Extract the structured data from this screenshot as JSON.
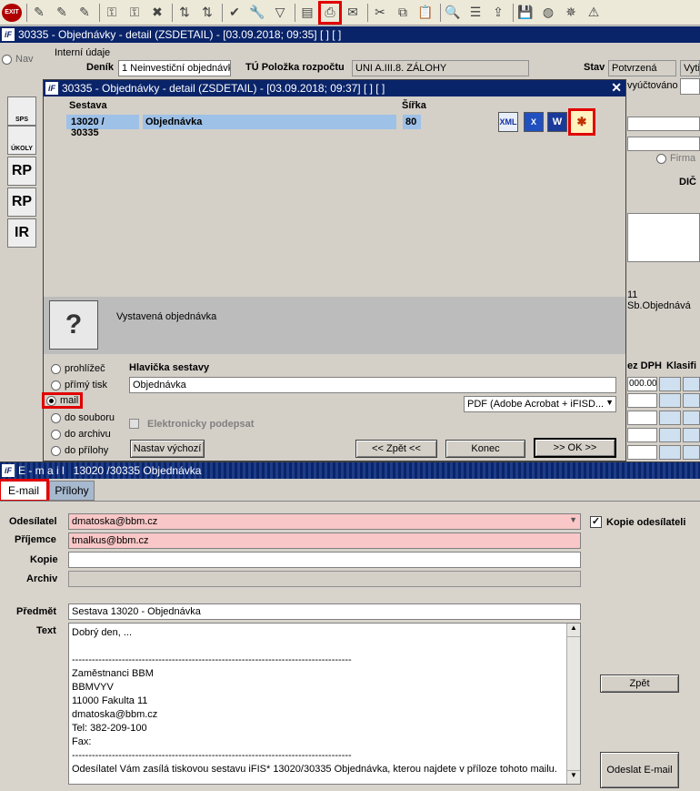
{
  "toolbar": {
    "icons": [
      "exit-icon",
      "edit-icon",
      "edit-icon",
      "edit-icon",
      "lock-icon",
      "lock-icon",
      "delete-icon",
      "sort-icon",
      "sort-icon",
      "check-icon",
      "wrench-icon",
      "filter-icon",
      "print-preview-icon",
      "print-icon",
      "email-icon",
      "cut-icon",
      "copy-icon",
      "paste-icon",
      "find-icon",
      "list-icon",
      "export-icon",
      "save-icon",
      "globe-icon",
      "wheel-icon",
      "sign-icon"
    ],
    "exit_label": "EXIT"
  },
  "main_window": {
    "title": "30335 - Objednávky - detail (ZSDETAIL) - [03.09.2018; 09:35]  [ ]  [ ]",
    "nav_label": "Nav",
    "group_label": "Interní údaje",
    "denik_label": "Deník",
    "denik_value": "1 Neinvestiční objednávk",
    "tu_label": "TÚ Položka rozpočtu",
    "tu_value": "UNI A.III.8. ZÁLOHY",
    "stav_label": "Stav",
    "stav_value": "Potvrzená",
    "stav_extra": "Vyti",
    "vyuctovano": "vyúčtováno",
    "firma_label": "Firma",
    "dic_label": "DIČ",
    "sb_obj": "11 Sb.Objednává",
    "col_dph": "ez DPH",
    "col_klasif": "Klasifi",
    "amount": "000.00"
  },
  "sidebar": [
    "SPS",
    "ÚKOLY",
    "RP",
    "RP",
    "IR"
  ],
  "report_dialog": {
    "title": "30335 - Objednávky - detail (ZSDETAIL) - [03.09.2018; 09:37]  [ ]  [ ]",
    "col_sestava": "Sestava",
    "col_sirka": "Šířka",
    "row_code": "13020 / 30335",
    "row_name": "Objednávka",
    "row_width": "80",
    "format_icons": [
      "XML",
      "X",
      "W",
      "✱"
    ],
    "description": "Vystavená objednávka",
    "output_options": [
      "prohlížeč",
      "přímý tisk",
      "mail",
      "do souboru",
      "do archivu",
      "do přílohy"
    ],
    "selected_option": "mail",
    "header_label": "Hlavička sestavy",
    "header_value": "Objednávka",
    "format_select": "PDF (Adobe Acrobat + iFISD...",
    "e_sign_label": "Elektronicky podepsat",
    "btn_default": "Nastav výchozí",
    "btn_back": "<< Zpět <<",
    "btn_end": "Konec",
    "btn_ok": ">> OK >>"
  },
  "email_window": {
    "title": "E - m a i l   13020 /30335 Objednávka",
    "tabs": [
      "E-mail",
      "Přílohy"
    ],
    "active_tab": "E-mail",
    "from_label": "Odesílatel",
    "from_value": "dmatoska@bbm.cz",
    "copy_sender_label": "Kopie odesílateli",
    "copy_sender_checked": true,
    "to_label": "Příjemce",
    "to_value": "tmalkus@bbm.cz",
    "cc_label": "Kopie",
    "cc_value": "",
    "archive_label": "Archiv",
    "archive_value": "",
    "subject_label": "Předmět",
    "subject_value": "Sestava 13020 - Objednávka",
    "text_label": "Text",
    "body_text": "Dobrý den, ...\n\n------------------------------------------------------------------------------------\nZaměstnanci BBM\nBBMVYV\n11000 Fakulta 11\ndmatoska@bbm.cz\nTel: 382-209-100\nFax:\n------------------------------------------------------------------------------------\nOdesílatel Vám zasílá tiskovou sestavu iFIS* 13020/30335 Objednávka, kterou najdete v příloze tohoto mailu.",
    "btn_back": "Zpět",
    "btn_send": "Odeslat E-mail"
  }
}
